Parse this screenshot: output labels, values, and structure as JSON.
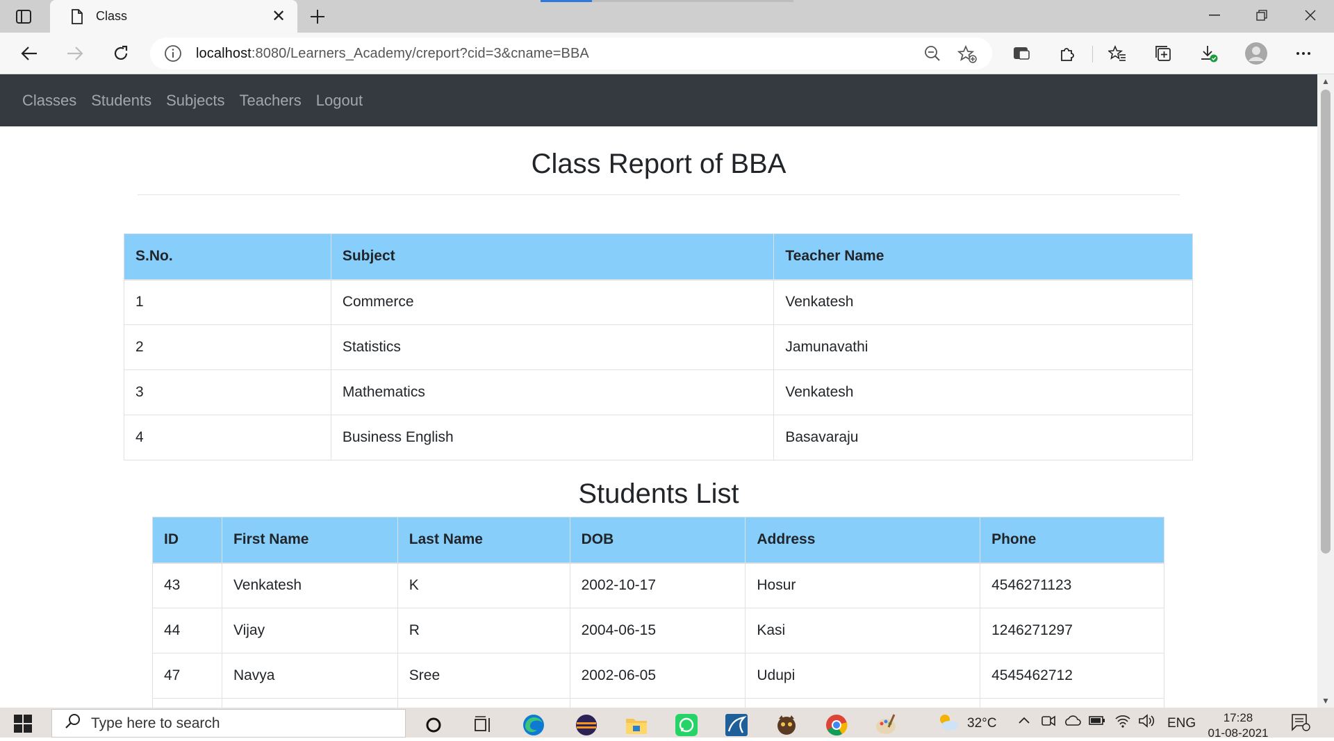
{
  "browser": {
    "tab_title": "Class",
    "url_host": "localhost",
    "url_rest": ":8080/Learners_Academy/creport?cid=3&cname=BBA"
  },
  "navbar": {
    "items": [
      "Classes",
      "Students",
      "Subjects",
      "Teachers",
      "Logout"
    ]
  },
  "report": {
    "title": "Class Report of BBA",
    "subjects_table": {
      "headers": [
        "S.No.",
        "Subject",
        "Teacher Name"
      ],
      "rows": [
        [
          "1",
          "Commerce",
          "Venkatesh"
        ],
        [
          "2",
          "Statistics",
          "Jamunavathi"
        ],
        [
          "3",
          "Mathematics",
          "Venkatesh"
        ],
        [
          "4",
          "Business English",
          "Basavaraju"
        ]
      ]
    },
    "students_title": "Students List",
    "students_table": {
      "headers": [
        "ID",
        "First Name",
        "Last Name",
        "DOB",
        "Address",
        "Phone"
      ],
      "rows": [
        [
          "43",
          "Venkatesh",
          "K",
          "2002-10-17",
          "Hosur",
          "4546271123"
        ],
        [
          "44",
          "Vijay",
          "R",
          "2004-06-15",
          "Kasi",
          "1246271297"
        ],
        [
          "47",
          "Navya",
          "Sree",
          "2002-06-05",
          "Udupi",
          "4545462712"
        ]
      ]
    }
  },
  "taskbar": {
    "search_placeholder": "Type here to search",
    "weather": "32°C",
    "language": "ENG",
    "time": "17:28",
    "date": "01-08-2021"
  },
  "colors": {
    "navbar_bg": "#343a40",
    "table_header_bg": "#87cefa"
  }
}
